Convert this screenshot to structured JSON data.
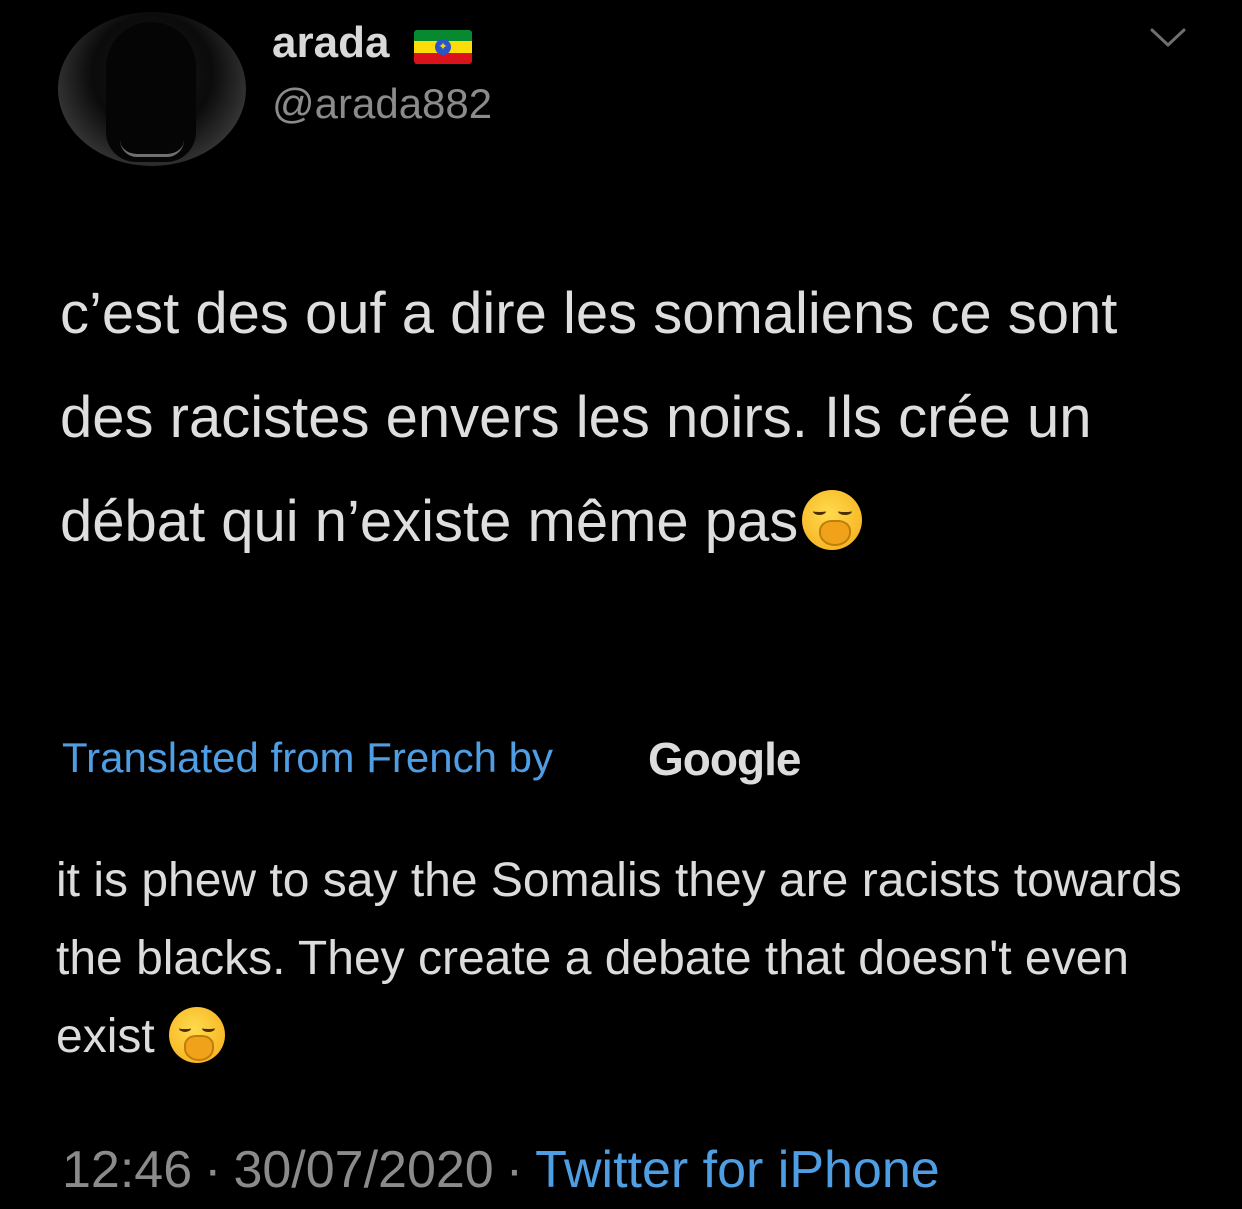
{
  "user": {
    "display_name": "arada",
    "flag_icon": "ethiopia-flag",
    "handle": "@arada882"
  },
  "tweet": {
    "text": "c’est des ouf a dire les somaliens ce sont des racistes envers les noirs. Ils crée un débat qui n’existe même pas",
    "emoji": "yawning-face-emoji"
  },
  "translation": {
    "label": "Translated from French by",
    "provider": "Google",
    "text": "it is phew to say the Somalis they are racists towards the blacks. They create a debate that doesn't even exist"
  },
  "meta": {
    "time": "12:46",
    "separator": "·",
    "date": "30/07/2020",
    "source": "Twitter for iPhone"
  },
  "colors": {
    "background": "#000000",
    "link": "#4f9de3",
    "secondary_text": "#8b8b8b",
    "primary_text": "#dedede"
  }
}
